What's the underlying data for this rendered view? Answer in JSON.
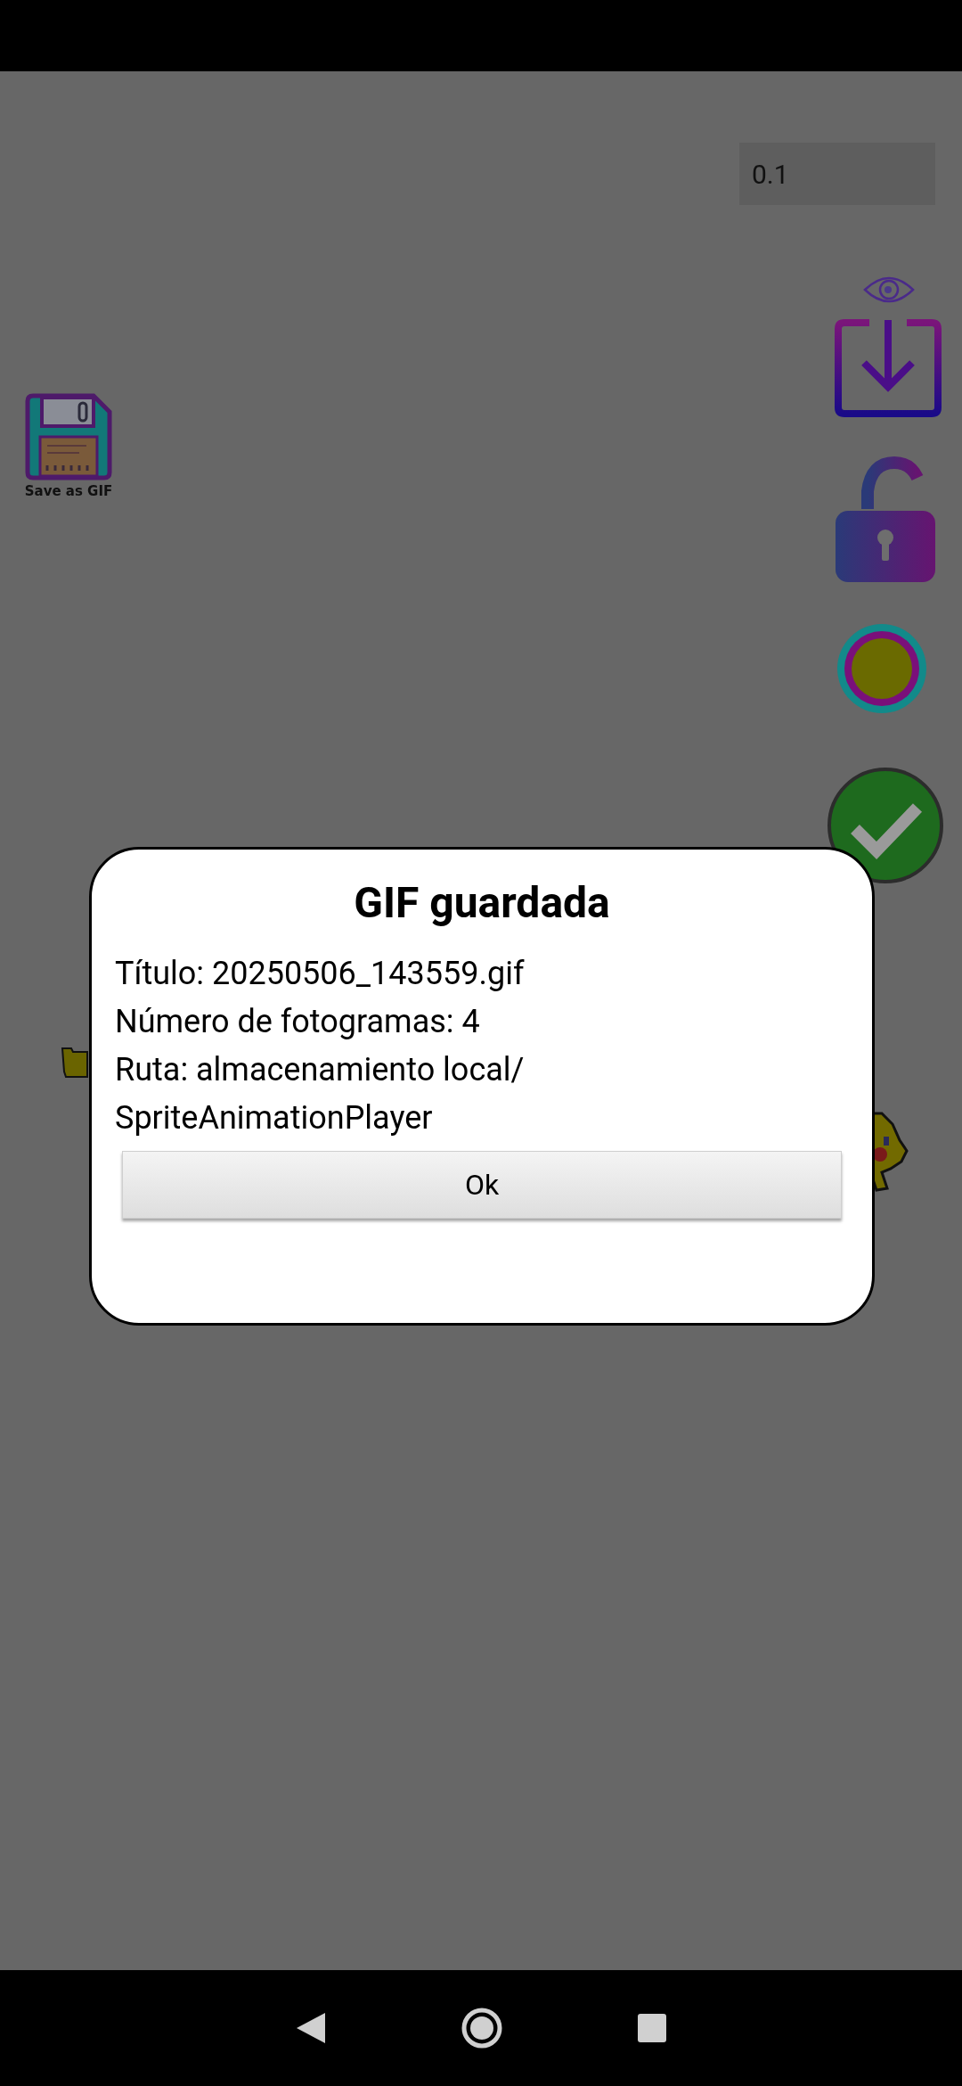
{
  "speed_field": {
    "value": "0.1"
  },
  "save_gif": {
    "label": "Save as GIF"
  },
  "dialog": {
    "title": "GIF guardada",
    "lines": [
      "Título: 20250506_143559.gif",
      "Número de fotogramas: 4",
      "Ruta: almacenamiento local/",
      "SpriteAnimationPlayer"
    ],
    "button": "Ok"
  }
}
